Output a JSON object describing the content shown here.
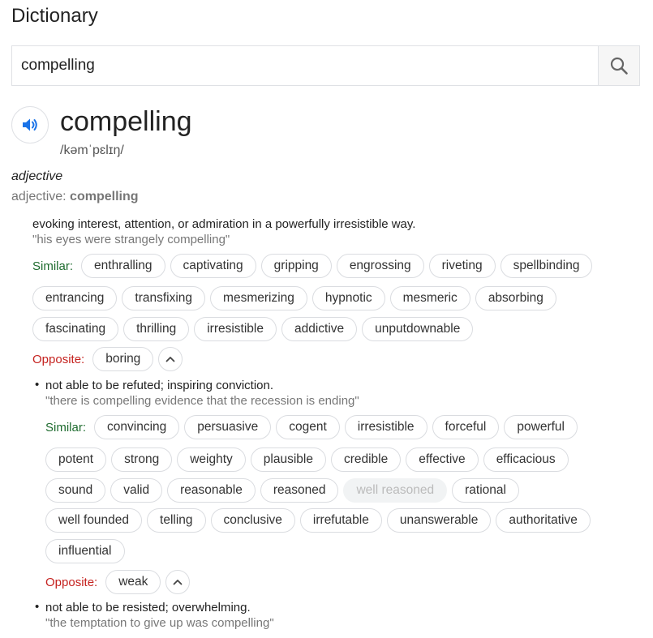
{
  "title": "Dictionary",
  "search": {
    "value": "compelling"
  },
  "entry": {
    "word": "compelling",
    "phonetic": "/kəmˈpɛlɪŋ/",
    "pos": "adjective",
    "pos_prefix": "adjective: ",
    "pos_word": "compelling"
  },
  "labels": {
    "similar": "Similar:",
    "opposite": "Opposite:"
  },
  "senses": [
    {
      "definition": "evoking interest, attention, or admiration in a powerfully irresistible way.",
      "example": "\"his eyes were strangely compelling\"",
      "similar_rows": [
        [
          "enthralling",
          "captivating",
          "gripping",
          "engrossing",
          "riveting",
          "spellbinding"
        ],
        [
          "entrancing",
          "transfixing",
          "mesmerizing",
          "hypnotic",
          "mesmeric",
          "absorbing"
        ],
        [
          "fascinating",
          "thrilling",
          "irresistible",
          "addictive",
          "unputdownable"
        ]
      ],
      "opposite": [
        "boring"
      ]
    },
    {
      "bullet": "•",
      "definition": "not able to be refuted; inspiring conviction.",
      "example": "\"there is compelling evidence that the recession is ending\"",
      "similar_rows": [
        [
          "convincing",
          "persuasive",
          "cogent",
          "irresistible",
          "forceful",
          "powerful"
        ],
        [
          "potent",
          "strong",
          "weighty",
          "plausible",
          "credible",
          "effective",
          "efficacious"
        ],
        [
          "sound",
          "valid",
          "reasonable",
          "reasoned",
          "well reasoned",
          "rational"
        ],
        [
          "well founded",
          "telling",
          "conclusive",
          "irrefutable",
          "unanswerable",
          "authoritative"
        ],
        [
          "influential"
        ]
      ],
      "opposite": [
        "weak"
      ]
    },
    {
      "bullet": "•",
      "definition": "not able to be resisted; overwhelming.",
      "example": "\"the temptation to give up was compelling\""
    }
  ],
  "colors": {
    "similar_label": "#1e6b2e",
    "opposite_label": "#c5221f",
    "speaker_icon": "#1a73e8"
  },
  "icons": {
    "search": "search-icon",
    "speaker": "speaker-icon",
    "expand": "chevron-up-icon"
  }
}
